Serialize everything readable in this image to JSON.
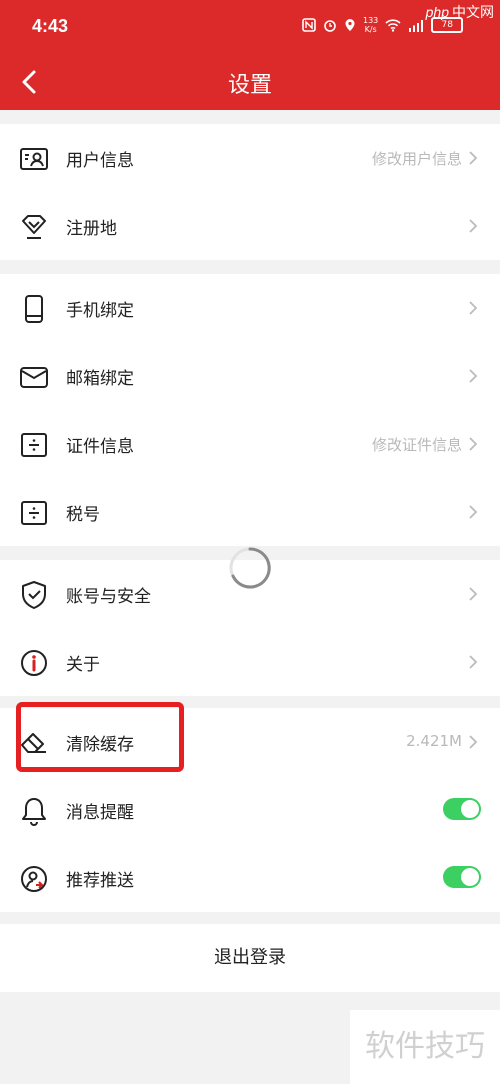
{
  "status_bar": {
    "time": "4:43",
    "net_speed_value": "133",
    "net_speed_unit": "K/s",
    "battery": "78"
  },
  "watermark_top": {
    "brand": "php",
    "text": "中文网"
  },
  "nav": {
    "title": "设置",
    "back_icon": "chevron-left-icon"
  },
  "group1": [
    {
      "label": "用户信息",
      "value": "修改用户信息",
      "icon": "id-card-icon"
    },
    {
      "label": "注册地",
      "value": "",
      "icon": "location-diamond-icon"
    }
  ],
  "group2": [
    {
      "label": "手机绑定",
      "value": "",
      "icon": "phone-icon"
    },
    {
      "label": "邮箱绑定",
      "value": "",
      "icon": "mail-icon"
    },
    {
      "label": "证件信息",
      "value": "修改证件信息",
      "icon": "document-icon"
    },
    {
      "label": "税号",
      "value": "",
      "icon": "tax-icon"
    }
  ],
  "group3": [
    {
      "label": "账号与安全",
      "value": "",
      "icon": "shield-check-icon"
    },
    {
      "label": "关于",
      "value": "",
      "icon": "info-icon"
    }
  ],
  "group4": [
    {
      "label": "清除缓存",
      "value": "2.421M",
      "icon": "eraser-icon"
    },
    {
      "label": "消息提醒",
      "toggle": true,
      "icon": "bell-icon"
    },
    {
      "label": "推荐推送",
      "toggle": true,
      "icon": "recommend-user-icon"
    }
  ],
  "logout": {
    "label": "退出登录"
  },
  "watermark_bottom": {
    "text": "软件技巧"
  },
  "colors": {
    "brand_red": "#dc2a2a",
    "toggle_green": "#3ccf61",
    "highlight_red": "#e62020"
  }
}
